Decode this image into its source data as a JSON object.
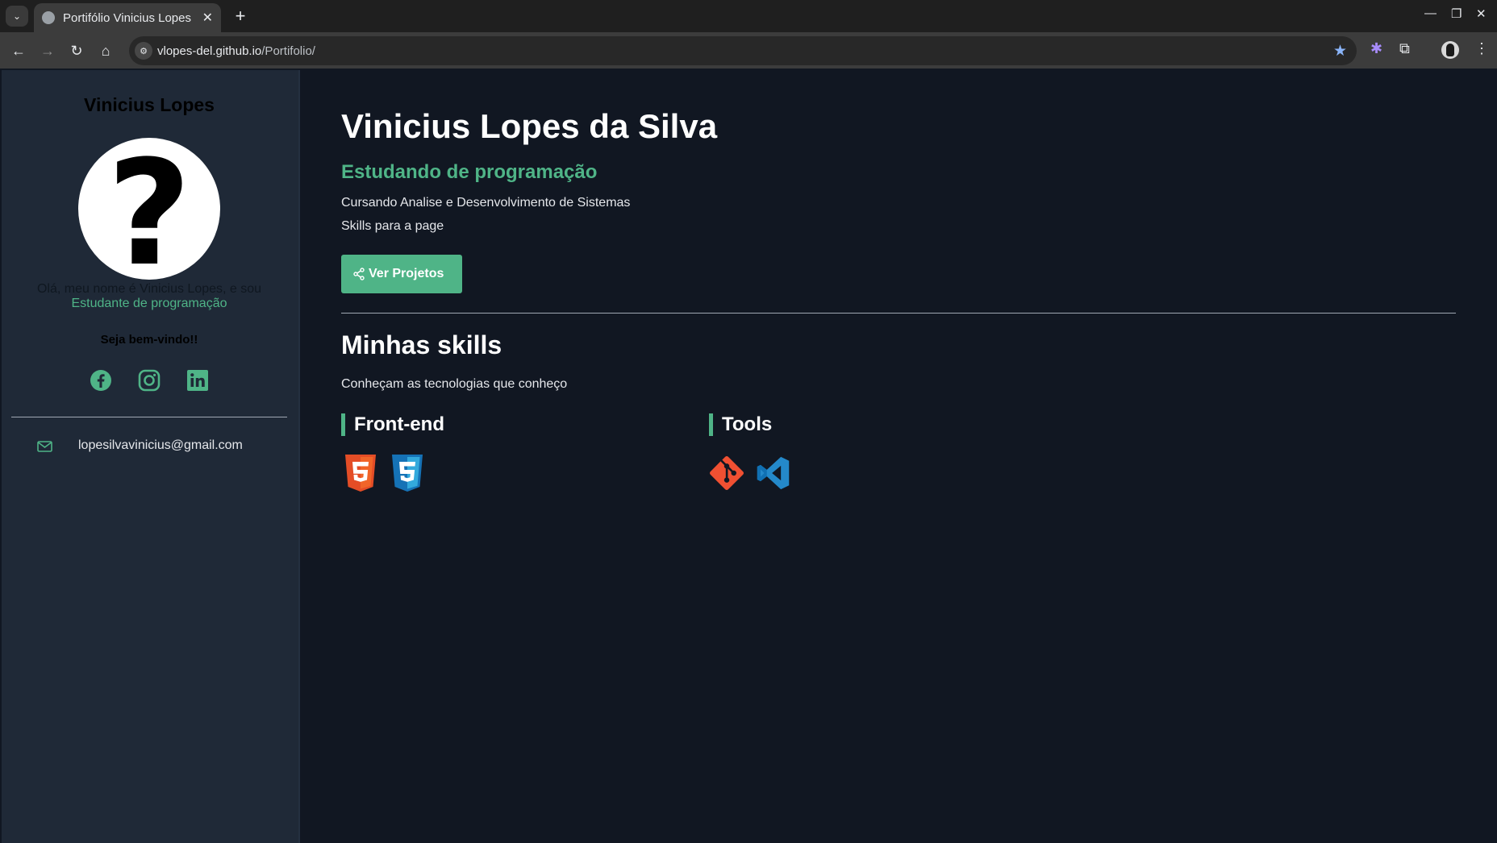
{
  "browser": {
    "tab_title": "Portifólio Vinicius Lopes",
    "url_domain": "vlopes-del.github.io",
    "url_path": "/Portifolio/"
  },
  "sidebar": {
    "name": "Vinicius Lopes",
    "avatar_symbol": "?",
    "intro": "Olá, meu nome é Vinicius Lopes, e sou",
    "role": "Estudante de programação",
    "welcome": "Seja bem-vindo!!",
    "socials": [
      "facebook-icon",
      "instagram-icon",
      "linkedin-icon"
    ],
    "email": "lopesilvavinicius@gmail.com"
  },
  "main": {
    "title": "Vinicius Lopes da Silva",
    "subtitle": "Estudando de programação",
    "line1": "Cursando Analise e Desenvolvimento de Sistemas",
    "line2": "Skills para a page",
    "projects_button": "Ver Projetos",
    "skills_title": "Minhas skills",
    "skills_desc": "Conheçam as tecnologias que conheço",
    "categories": [
      {
        "title": "Front-end",
        "icons": [
          "html5-icon",
          "css3-icon"
        ]
      },
      {
        "title": "Tools",
        "icons": [
          "git-icon",
          "vscode-icon"
        ]
      }
    ]
  },
  "colors": {
    "accent": "#4fb487",
    "background": "#111722",
    "sidebar": "#1f2937"
  }
}
